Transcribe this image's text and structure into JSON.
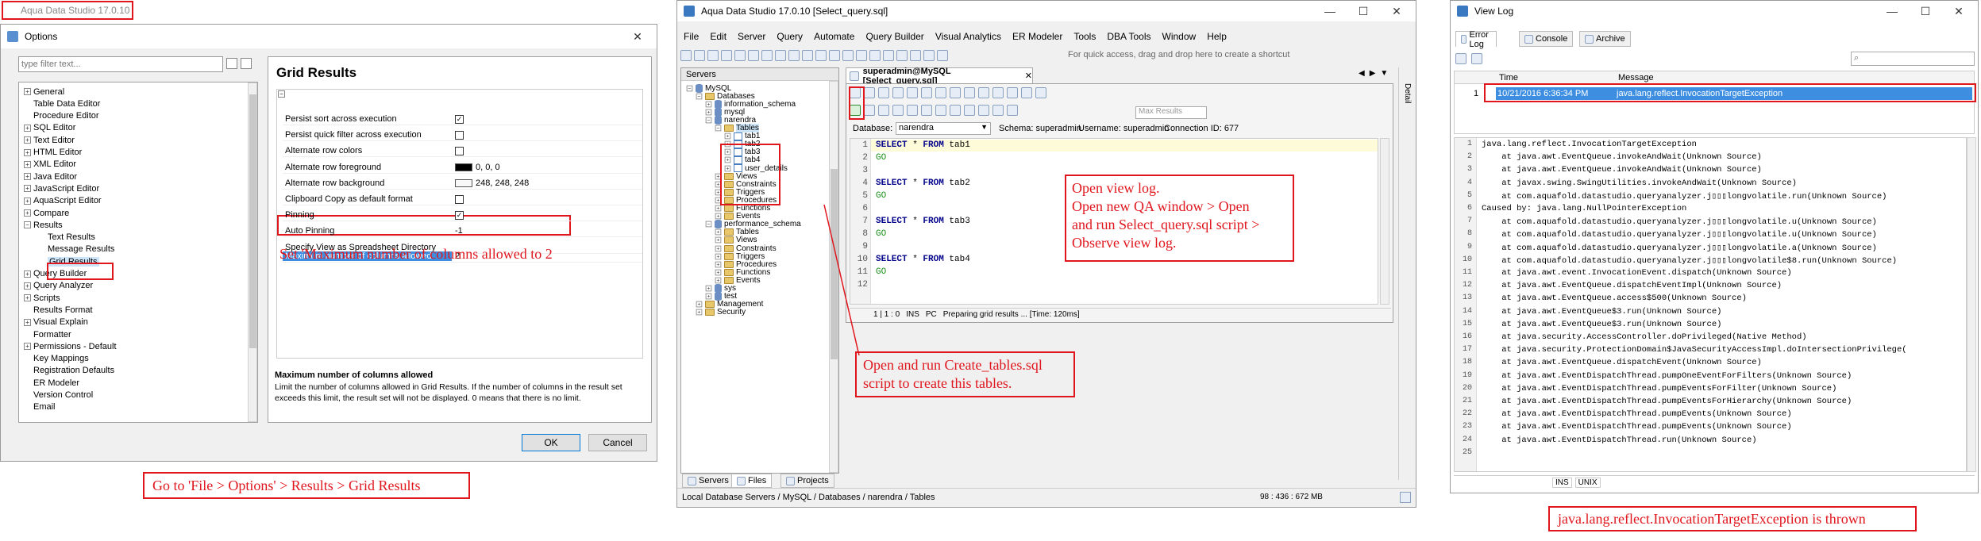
{
  "win1": {
    "app_title": "Aqua Data Studio 17.0.10",
    "options_title": "Options",
    "filter_placeholder": "type filter text...",
    "tree": [
      "General",
      "Table Data Editor",
      "Procedure Editor",
      "SQL Editor",
      "Text Editor",
      "HTML Editor",
      "XML Editor",
      "Java Editor",
      "JavaScript Editor",
      "AquaScript Editor",
      "Compare",
      "Results",
      "Text Results",
      "Message Results",
      "Grid Results",
      "Query Builder",
      "Query Analyzer",
      "Scripts",
      "Results Format",
      "Visual Explain",
      "Formatter",
      "Permissions - Default",
      "Key Mappings",
      "Registration Defaults",
      "ER Modeler",
      "Version Control",
      "Email"
    ],
    "panel_title": "Grid Results",
    "props": [
      {
        "k": "Persist sort across execution",
        "v": "✓"
      },
      {
        "k": "Persist quick filter across execution",
        "v": ""
      },
      {
        "k": "Alternate row colors",
        "v": ""
      },
      {
        "k": "Alternate row foreground",
        "v": "0, 0, 0"
      },
      {
        "k": "Alternate row background",
        "v": "248, 248, 248"
      },
      {
        "k": "Clipboard Copy as default format",
        "v": ""
      },
      {
        "k": "Pinning",
        "v": "✓"
      },
      {
        "k": "Auto Pinning",
        "v": "-1"
      },
      {
        "k": "Specify View as Spreadsheet Directory",
        "v": ""
      },
      {
        "k": "Maximum number of columns allowed",
        "v": "2"
      }
    ],
    "desc_title": "Maximum number of columns allowed",
    "desc_text": "Limit the number of columns allowed in Grid Results. If the number of columns in the result set exceeds this limit, the result set will not be displayed. 0 means that there is no limit.",
    "ok": "OK",
    "cancel": "Cancel",
    "note_set": "Set 'Maximum number of columns allowed to 2",
    "note_goto": "Go to 'File > Options' > Results > Grid Results"
  },
  "win2": {
    "title": "Aqua Data Studio 17.0.10 [Select_query.sql]",
    "menu": [
      "File",
      "Edit",
      "Server",
      "Query",
      "Automate",
      "Query Builder",
      "Visual Analytics",
      "ER Modeler",
      "Tools",
      "DBA Tools",
      "Window",
      "Help"
    ],
    "quick_access": "For quick access, drag and drop here to create a shortcut",
    "servers_label": "Servers",
    "editor_tab": "superadmin@MySQL [Select_query.sql]",
    "tree": [
      {
        "t": "MySQL",
        "lvl": 0,
        "icon": "db"
      },
      {
        "t": "Databases",
        "lvl": 1,
        "icon": "fold"
      },
      {
        "t": "information_schema",
        "lvl": 2,
        "icon": "db"
      },
      {
        "t": "mysql",
        "lvl": 2,
        "icon": "db"
      },
      {
        "t": "narendra",
        "lvl": 2,
        "icon": "db"
      },
      {
        "t": "Tables",
        "lvl": 3,
        "icon": "fold"
      },
      {
        "t": "tab1",
        "lvl": 4,
        "icon": "tbl"
      },
      {
        "t": "tab2",
        "lvl": 4,
        "icon": "tbl"
      },
      {
        "t": "tab3",
        "lvl": 4,
        "icon": "tbl"
      },
      {
        "t": "tab4",
        "lvl": 4,
        "icon": "tbl"
      },
      {
        "t": "user_details",
        "lvl": 4,
        "icon": "tbl"
      },
      {
        "t": "Views",
        "lvl": 3,
        "icon": "fold"
      },
      {
        "t": "Constraints",
        "lvl": 3,
        "icon": "fold"
      },
      {
        "t": "Triggers",
        "lvl": 3,
        "icon": "fold"
      },
      {
        "t": "Procedures",
        "lvl": 3,
        "icon": "fold"
      },
      {
        "t": "Functions",
        "lvl": 3,
        "icon": "fold"
      },
      {
        "t": "Events",
        "lvl": 3,
        "icon": "fold"
      },
      {
        "t": "performance_schema",
        "lvl": 2,
        "icon": "db"
      },
      {
        "t": "Tables",
        "lvl": 3,
        "icon": "fold"
      },
      {
        "t": "Views",
        "lvl": 3,
        "icon": "fold"
      },
      {
        "t": "Constraints",
        "lvl": 3,
        "icon": "fold"
      },
      {
        "t": "Triggers",
        "lvl": 3,
        "icon": "fold"
      },
      {
        "t": "Procedures",
        "lvl": 3,
        "icon": "fold"
      },
      {
        "t": "Functions",
        "lvl": 3,
        "icon": "fold"
      },
      {
        "t": "Events",
        "lvl": 3,
        "icon": "fold"
      },
      {
        "t": "sys",
        "lvl": 2,
        "icon": "db"
      },
      {
        "t": "test",
        "lvl": 2,
        "icon": "db"
      },
      {
        "t": "Management",
        "lvl": 1,
        "icon": "fold"
      },
      {
        "t": "Security",
        "lvl": 1,
        "icon": "fold"
      }
    ],
    "db_label": "Database:",
    "db_value": "narendra",
    "schema": "Schema:  superadmin",
    "username": "Username:  superadmin",
    "conn": "Connection ID:  677",
    "max_results": "Max Results",
    "code": [
      {
        "n": "1",
        "kw": "SELECT",
        "rest": " * ",
        "kw2": "FROM",
        "tbl": " tab1"
      },
      {
        "n": "2",
        "go": "GO"
      },
      {
        "n": "3"
      },
      {
        "n": "4",
        "kw": "SELECT",
        "rest": " * ",
        "kw2": "FROM",
        "tbl": " tab2"
      },
      {
        "n": "5",
        "go": "GO"
      },
      {
        "n": "6"
      },
      {
        "n": "7",
        "kw": "SELECT",
        "rest": " * ",
        "kw2": "FROM",
        "tbl": " tab3"
      },
      {
        "n": "8",
        "go": "GO"
      },
      {
        "n": "9"
      },
      {
        "n": "10",
        "kw": "SELECT",
        "rest": " * ",
        "kw2": "FROM",
        "tbl": " tab4"
      },
      {
        "n": "11",
        "go": "GO"
      },
      {
        "n": "12"
      }
    ],
    "status_pos": "1 | 1 : 0",
    "status_ins": "INS",
    "status_pc": "PC",
    "status_msg": "Preparing grid results ... [Time: 120ms]",
    "note_view": "Open view log.\nOpen new QA window > Open\nand run Select_query.sql script >\nObserve view log.",
    "note_create": "Open and run Create_tables.sql\nscript to create this tables.",
    "bottom_tabs": [
      "Servers",
      "Files",
      "Projects"
    ],
    "footer_path": "Local Database Servers / MySQL / Databases / narendra / Tables",
    "footer_mem": "98 : 436 : 672 MB",
    "side_label": "Detail"
  },
  "win3": {
    "title": "View Log",
    "tabs": [
      "Error Log",
      "Console",
      "Archive"
    ],
    "col_time": "Time",
    "col_message": "Message",
    "row_num": "1",
    "row_time": "10/21/2016 6:36:34 PM",
    "row_msg": "java.lang.reflect.InvocationTargetException",
    "stack": [
      "java.lang.reflect.InvocationTargetException",
      "    at java.awt.EventQueue.invokeAndWait(Unknown Source)",
      "    at java.awt.EventQueue.invokeAndWait(Unknown Source)",
      "    at javax.swing.SwingUtilities.invokeAndWait(Unknown Source)",
      "    at com.aquafold.datastudio.queryanalyzer.j▯▯▯longvolatile.run(Unknown Source)",
      "Caused by: java.lang.NullPointerException",
      "    at com.aquafold.datastudio.queryanalyzer.j▯▯▯longvolatile.u(Unknown Source)",
      "    at com.aquafold.datastudio.queryanalyzer.j▯▯▯longvolatile.u(Unknown Source)",
      "    at com.aquafold.datastudio.queryanalyzer.j▯▯▯longvolatile.a(Unknown Source)",
      "    at com.aquafold.datastudio.queryanalyzer.j▯▯▯longvolatile$8.run(Unknown Source)",
      "    at java.awt.event.InvocationEvent.dispatch(Unknown Source)",
      "    at java.awt.EventQueue.dispatchEventImpl(Unknown Source)",
      "    at java.awt.EventQueue.access$500(Unknown Source)",
      "    at java.awt.EventQueue$3.run(Unknown Source)",
      "    at java.awt.EventQueue$3.run(Unknown Source)",
      "    at java.security.AccessController.doPrivileged(Native Method)",
      "    at java.security.ProtectionDomain$JavaSecurityAccessImpl.doIntersectionPrivilege(",
      "    at java.awt.EventQueue.dispatchEvent(Unknown Source)",
      "    at java.awt.EventDispatchThread.pumpOneEventForFilters(Unknown Source)",
      "    at java.awt.EventDispatchThread.pumpEventsForFilter(Unknown Source)",
      "    at java.awt.EventDispatchThread.pumpEventsForHierarchy(Unknown Source)",
      "    at java.awt.EventDispatchThread.pumpEvents(Unknown Source)",
      "    at java.awt.EventDispatchThread.pumpEvents(Unknown Source)",
      "    at java.awt.EventDispatchThread.run(Unknown Source)",
      ""
    ],
    "status_ins": "INS",
    "status_unix": "UNIX",
    "note": "java.lang.reflect.InvocationTargetException is thrown"
  }
}
